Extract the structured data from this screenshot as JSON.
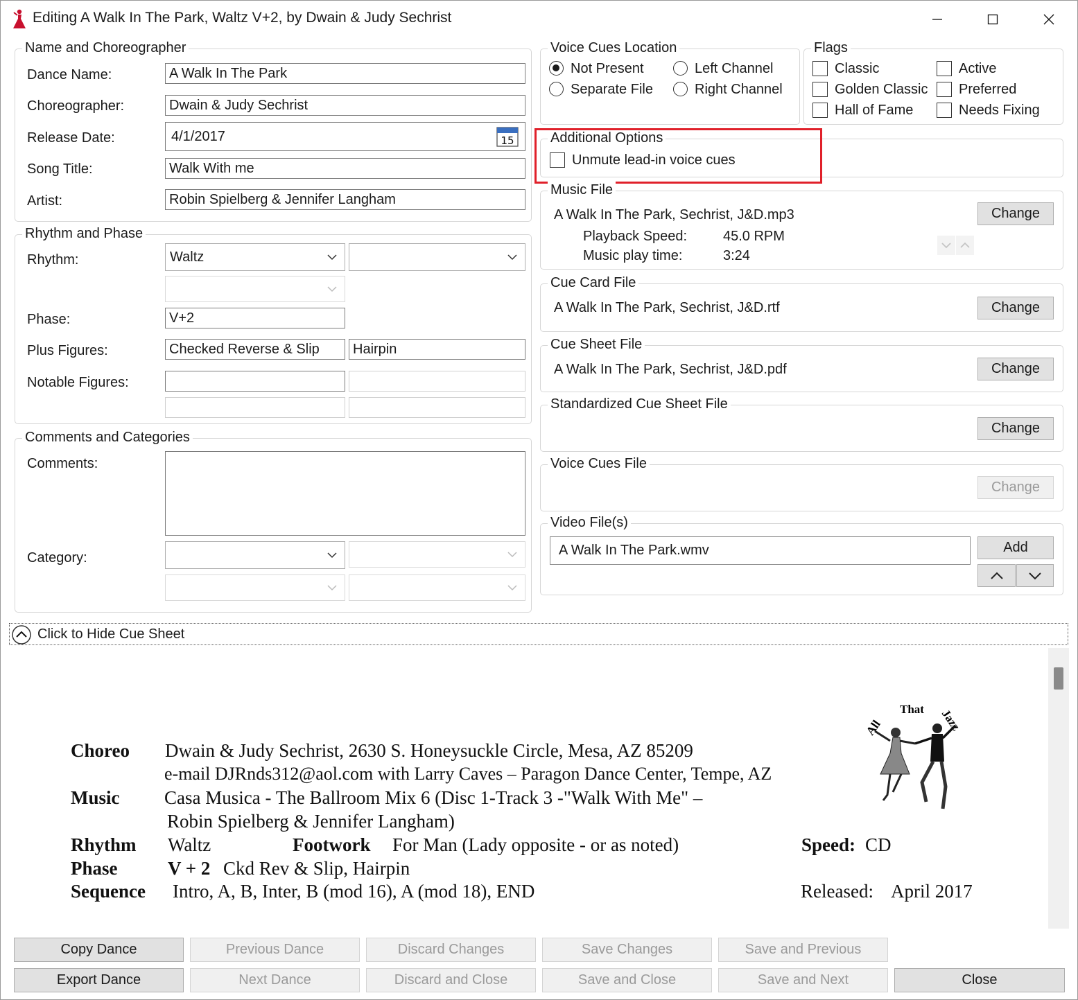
{
  "window": {
    "title": "Editing A Walk In The Park, Waltz V+2, by Dwain & Judy Sechrist"
  },
  "name_group": {
    "title": "Name and Choreographer",
    "dance_name_label": "Dance Name:",
    "dance_name": "A Walk In The Park",
    "choreographer_label": "Choreographer:",
    "choreographer": "Dwain & Judy Sechrist",
    "release_date_label": "Release Date:",
    "release_date": "4/1/2017",
    "calendar_day": "15",
    "song_title_label": "Song Title:",
    "song_title": "Walk With me",
    "artist_label": "Artist:",
    "artist": "Robin Spielberg & Jennifer Langham"
  },
  "rhythm_group": {
    "title": "Rhythm and Phase",
    "rhythm_label": "Rhythm:",
    "rhythm": "Waltz",
    "rhythm2": "",
    "rhythm3": "",
    "phase_label": "Phase:",
    "phase": "V+2",
    "plus_label": "Plus Figures:",
    "plus1": "Checked Reverse & Slip",
    "plus2": "Hairpin",
    "notable_label": "Notable Figures:"
  },
  "comments_group": {
    "title": "Comments and Categories",
    "comments_label": "Comments:",
    "comments": "",
    "category_label": "Category:"
  },
  "voice_location": {
    "title": "Voice Cues Location",
    "options": [
      "Not Present",
      "Left Channel",
      "Separate File",
      "Right Channel"
    ],
    "selected": "Not Present"
  },
  "flags": {
    "title": "Flags",
    "items": [
      "Classic",
      "Active",
      "Golden Classic",
      "Preferred",
      "Hall of Fame",
      "Needs Fixing"
    ]
  },
  "additional_options": {
    "title": "Additional Options",
    "unmute_label": "Unmute lead-in voice cues"
  },
  "music_file": {
    "title": "Music File",
    "filename": "A Walk In The Park, Sechrist, J&D.mp3",
    "speed_label": "Playback Speed:",
    "speed": "45.0 RPM",
    "time_label": "Music play time:",
    "time": "3:24",
    "change": "Change"
  },
  "cue_card_file": {
    "title": "Cue Card File",
    "filename": "A Walk In The Park, Sechrist, J&D.rtf",
    "change": "Change"
  },
  "cue_sheet_file": {
    "title": "Cue Sheet File",
    "filename": "A Walk In The Park, Sechrist, J&D.pdf",
    "change": "Change"
  },
  "std_cue_sheet_file": {
    "title": "Standardized Cue Sheet File",
    "change": "Change"
  },
  "voice_cues_file": {
    "title": "Voice Cues File",
    "change": "Change"
  },
  "video_files": {
    "title": "Video File(s)",
    "filename": "A Walk In The Park.wmv",
    "add": "Add"
  },
  "cue_toggle": {
    "label": "Click to Hide Cue Sheet"
  },
  "cue_sheet": {
    "logo_text": {
      "left": "All",
      "middle": "That",
      "right": "Jazz"
    },
    "choreo_key": "Choreo",
    "choreo_line1": "Dwain & Judy Sechrist, 2630 S. Honeysuckle Circle, Mesa, AZ 85209",
    "choreo_line2": "e-mail  DJRnds312@aol.com   with Larry Caves – Paragon Dance Center, Tempe, AZ",
    "music_key": "Music",
    "music_line1": "Casa Musica - The Ballroom Mix 6 (Disc 1-Track 3 -\"Walk With Me\" –",
    "music_line2": "Robin Spielberg & Jennifer Langham)",
    "rhythm_key": "Rhythm",
    "rhythm_val": "Waltz",
    "footwork_key": "Footwork",
    "footwork_val": "For Man  (Lady opposite - or as noted)",
    "speed_key": "Speed:",
    "speed_val": "CD",
    "phase_key": "Phase",
    "phase_val_bold": "V + 2",
    "phase_val": "Ckd Rev & Slip, Hairpin",
    "sequence_key": "Sequence",
    "sequence_val": "Intro, A, B, Inter, B (mod 16), A (mod 18), END",
    "released_key": "Released:",
    "released_val": "April 2017"
  },
  "buttons": {
    "copy_dance": "Copy Dance",
    "previous_dance": "Previous Dance",
    "discard_changes": "Discard Changes",
    "save_changes": "Save Changes",
    "save_previous": "Save and Previous",
    "export_dance": "Export Dance",
    "next_dance": "Next Dance",
    "discard_close": "Discard and Close",
    "save_close": "Save and Close",
    "save_next": "Save and Next",
    "close": "Close"
  },
  "colors": {
    "highlight": "#e0202a",
    "icon_red": "#c8102e"
  }
}
